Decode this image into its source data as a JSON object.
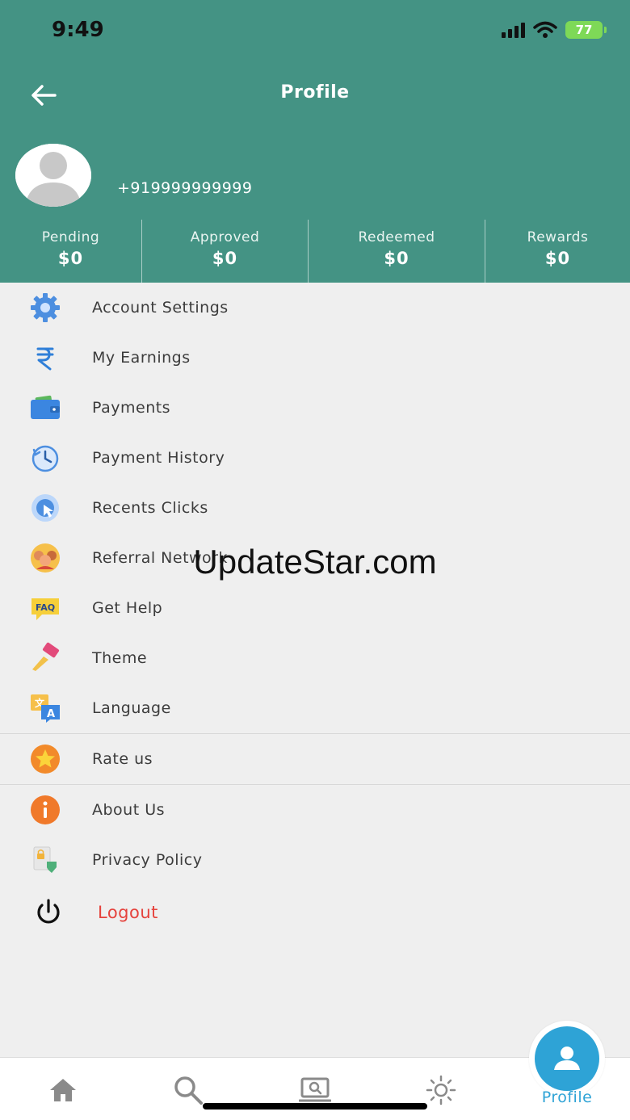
{
  "status_bar": {
    "time": "9:49",
    "battery": "77"
  },
  "header": {
    "title": "Profile"
  },
  "profile": {
    "phone": "+919999999999"
  },
  "stats": [
    {
      "label": "Pending",
      "value": "$0"
    },
    {
      "label": "Approved",
      "value": "$0"
    },
    {
      "label": "Redeemed",
      "value": "$0"
    },
    {
      "label": "Rewards",
      "value": "$0"
    }
  ],
  "menu": {
    "items": [
      {
        "label": "Account Settings",
        "icon": "gear-icon"
      },
      {
        "label": "My Earnings",
        "icon": "rupee-icon"
      },
      {
        "label": "Payments",
        "icon": "wallet-icon"
      },
      {
        "label": "Payment History",
        "icon": "history-clock-icon"
      },
      {
        "label": "Recents Clicks",
        "icon": "click-icon"
      },
      {
        "label": "Referral Network",
        "icon": "people-icon"
      },
      {
        "label": "Get Help",
        "icon": "faq-icon"
      },
      {
        "label": "Theme",
        "icon": "paint-brush-icon"
      },
      {
        "label": "Language",
        "icon": "translate-icon"
      },
      {
        "label": "Rate us",
        "icon": "star-icon"
      },
      {
        "label": "About Us",
        "icon": "info-icon"
      },
      {
        "label": "Privacy Policy",
        "icon": "privacy-lock-icon"
      },
      {
        "label": "Logout",
        "icon": "power-icon"
      }
    ]
  },
  "watermark": "UpdateStar.com",
  "bottom_nav": {
    "profile_label": "Profile"
  },
  "colors": {
    "header": "#449384",
    "accent": "#2ea3d6",
    "logout": "#e5423c"
  }
}
